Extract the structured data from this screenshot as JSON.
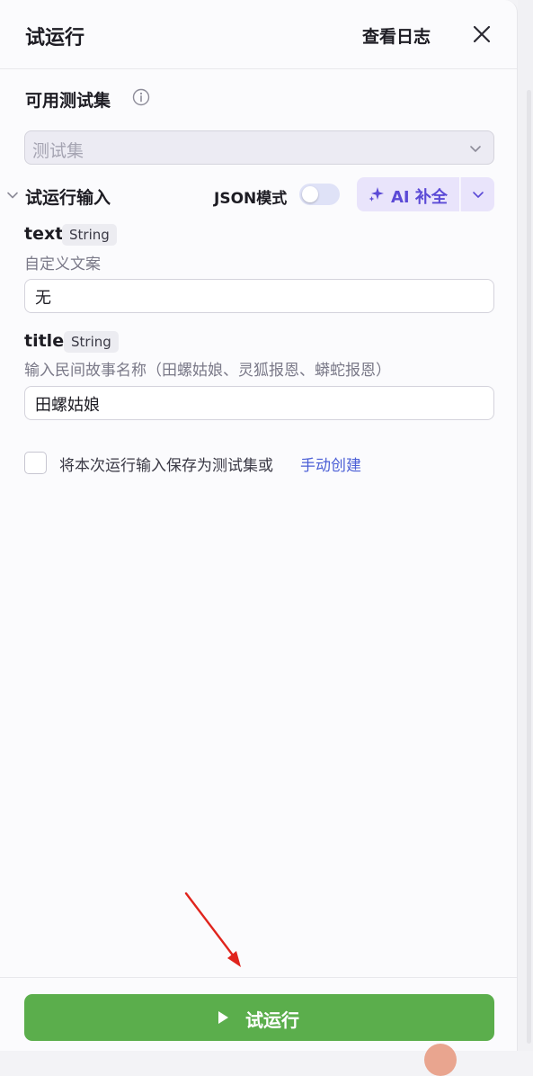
{
  "header": {
    "title": "试运行",
    "view_log": "查看日志",
    "close_icon": "close-icon"
  },
  "test_set": {
    "label": "可用测试集",
    "info_icon": "info-icon",
    "placeholder": "测试集"
  },
  "run_input": {
    "label": "试运行输入",
    "json_mode_label": "JSON模式",
    "json_mode_on": false,
    "ai_fill_label": "AI 补全",
    "accent_color": "#5b4ad6"
  },
  "params": [
    {
      "name": "text",
      "type": "String",
      "description": "自定义文案",
      "value": "无"
    },
    {
      "name": "title",
      "type": "String",
      "description": "输入民间故事名称（田螺姑娘、灵狐报恩、蟒蛇报恩）",
      "value": "田螺姑娘"
    }
  ],
  "save": {
    "text": "将本次运行输入保存为测试集或",
    "link": "手动创建",
    "checked": false
  },
  "footer": {
    "run_label": "试运行",
    "run_color": "#5bae4c"
  }
}
